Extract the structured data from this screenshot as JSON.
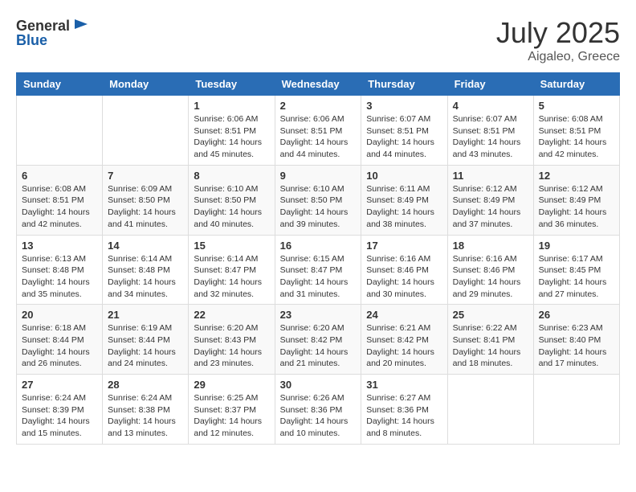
{
  "logo": {
    "text_general": "General",
    "text_blue": "Blue"
  },
  "title": {
    "month_year": "July 2025",
    "location": "Aigaleo, Greece"
  },
  "weekdays": [
    "Sunday",
    "Monday",
    "Tuesday",
    "Wednesday",
    "Thursday",
    "Friday",
    "Saturday"
  ],
  "weeks": [
    [
      {
        "day": "",
        "info": ""
      },
      {
        "day": "",
        "info": ""
      },
      {
        "day": "1",
        "info": "Sunrise: 6:06 AM\nSunset: 8:51 PM\nDaylight: 14 hours and 45 minutes."
      },
      {
        "day": "2",
        "info": "Sunrise: 6:06 AM\nSunset: 8:51 PM\nDaylight: 14 hours and 44 minutes."
      },
      {
        "day": "3",
        "info": "Sunrise: 6:07 AM\nSunset: 8:51 PM\nDaylight: 14 hours and 44 minutes."
      },
      {
        "day": "4",
        "info": "Sunrise: 6:07 AM\nSunset: 8:51 PM\nDaylight: 14 hours and 43 minutes."
      },
      {
        "day": "5",
        "info": "Sunrise: 6:08 AM\nSunset: 8:51 PM\nDaylight: 14 hours and 42 minutes."
      }
    ],
    [
      {
        "day": "6",
        "info": "Sunrise: 6:08 AM\nSunset: 8:51 PM\nDaylight: 14 hours and 42 minutes."
      },
      {
        "day": "7",
        "info": "Sunrise: 6:09 AM\nSunset: 8:50 PM\nDaylight: 14 hours and 41 minutes."
      },
      {
        "day": "8",
        "info": "Sunrise: 6:10 AM\nSunset: 8:50 PM\nDaylight: 14 hours and 40 minutes."
      },
      {
        "day": "9",
        "info": "Sunrise: 6:10 AM\nSunset: 8:50 PM\nDaylight: 14 hours and 39 minutes."
      },
      {
        "day": "10",
        "info": "Sunrise: 6:11 AM\nSunset: 8:49 PM\nDaylight: 14 hours and 38 minutes."
      },
      {
        "day": "11",
        "info": "Sunrise: 6:12 AM\nSunset: 8:49 PM\nDaylight: 14 hours and 37 minutes."
      },
      {
        "day": "12",
        "info": "Sunrise: 6:12 AM\nSunset: 8:49 PM\nDaylight: 14 hours and 36 minutes."
      }
    ],
    [
      {
        "day": "13",
        "info": "Sunrise: 6:13 AM\nSunset: 8:48 PM\nDaylight: 14 hours and 35 minutes."
      },
      {
        "day": "14",
        "info": "Sunrise: 6:14 AM\nSunset: 8:48 PM\nDaylight: 14 hours and 34 minutes."
      },
      {
        "day": "15",
        "info": "Sunrise: 6:14 AM\nSunset: 8:47 PM\nDaylight: 14 hours and 32 minutes."
      },
      {
        "day": "16",
        "info": "Sunrise: 6:15 AM\nSunset: 8:47 PM\nDaylight: 14 hours and 31 minutes."
      },
      {
        "day": "17",
        "info": "Sunrise: 6:16 AM\nSunset: 8:46 PM\nDaylight: 14 hours and 30 minutes."
      },
      {
        "day": "18",
        "info": "Sunrise: 6:16 AM\nSunset: 8:46 PM\nDaylight: 14 hours and 29 minutes."
      },
      {
        "day": "19",
        "info": "Sunrise: 6:17 AM\nSunset: 8:45 PM\nDaylight: 14 hours and 27 minutes."
      }
    ],
    [
      {
        "day": "20",
        "info": "Sunrise: 6:18 AM\nSunset: 8:44 PM\nDaylight: 14 hours and 26 minutes."
      },
      {
        "day": "21",
        "info": "Sunrise: 6:19 AM\nSunset: 8:44 PM\nDaylight: 14 hours and 24 minutes."
      },
      {
        "day": "22",
        "info": "Sunrise: 6:20 AM\nSunset: 8:43 PM\nDaylight: 14 hours and 23 minutes."
      },
      {
        "day": "23",
        "info": "Sunrise: 6:20 AM\nSunset: 8:42 PM\nDaylight: 14 hours and 21 minutes."
      },
      {
        "day": "24",
        "info": "Sunrise: 6:21 AM\nSunset: 8:42 PM\nDaylight: 14 hours and 20 minutes."
      },
      {
        "day": "25",
        "info": "Sunrise: 6:22 AM\nSunset: 8:41 PM\nDaylight: 14 hours and 18 minutes."
      },
      {
        "day": "26",
        "info": "Sunrise: 6:23 AM\nSunset: 8:40 PM\nDaylight: 14 hours and 17 minutes."
      }
    ],
    [
      {
        "day": "27",
        "info": "Sunrise: 6:24 AM\nSunset: 8:39 PM\nDaylight: 14 hours and 15 minutes."
      },
      {
        "day": "28",
        "info": "Sunrise: 6:24 AM\nSunset: 8:38 PM\nDaylight: 14 hours and 13 minutes."
      },
      {
        "day": "29",
        "info": "Sunrise: 6:25 AM\nSunset: 8:37 PM\nDaylight: 14 hours and 12 minutes."
      },
      {
        "day": "30",
        "info": "Sunrise: 6:26 AM\nSunset: 8:36 PM\nDaylight: 14 hours and 10 minutes."
      },
      {
        "day": "31",
        "info": "Sunrise: 6:27 AM\nSunset: 8:36 PM\nDaylight: 14 hours and 8 minutes."
      },
      {
        "day": "",
        "info": ""
      },
      {
        "day": "",
        "info": ""
      }
    ]
  ]
}
